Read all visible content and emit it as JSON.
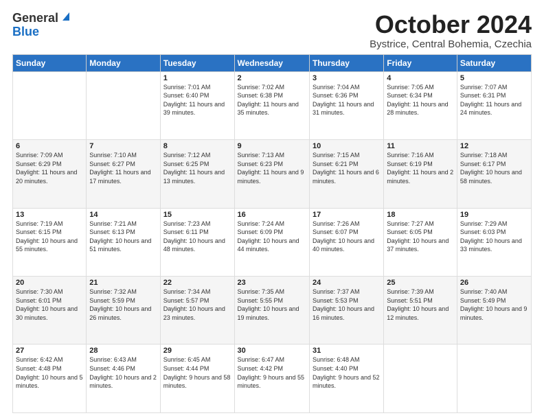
{
  "header": {
    "logo_general": "General",
    "logo_blue": "Blue",
    "month_title": "October 2024",
    "location": "Bystrice, Central Bohemia, Czechia"
  },
  "days_of_week": [
    "Sunday",
    "Monday",
    "Tuesday",
    "Wednesday",
    "Thursday",
    "Friday",
    "Saturday"
  ],
  "weeks": [
    [
      {
        "num": "",
        "info": ""
      },
      {
        "num": "",
        "info": ""
      },
      {
        "num": "1",
        "info": "Sunrise: 7:01 AM\nSunset: 6:40 PM\nDaylight: 11 hours and 39 minutes."
      },
      {
        "num": "2",
        "info": "Sunrise: 7:02 AM\nSunset: 6:38 PM\nDaylight: 11 hours and 35 minutes."
      },
      {
        "num": "3",
        "info": "Sunrise: 7:04 AM\nSunset: 6:36 PM\nDaylight: 11 hours and 31 minutes."
      },
      {
        "num": "4",
        "info": "Sunrise: 7:05 AM\nSunset: 6:34 PM\nDaylight: 11 hours and 28 minutes."
      },
      {
        "num": "5",
        "info": "Sunrise: 7:07 AM\nSunset: 6:31 PM\nDaylight: 11 hours and 24 minutes."
      }
    ],
    [
      {
        "num": "6",
        "info": "Sunrise: 7:09 AM\nSunset: 6:29 PM\nDaylight: 11 hours and 20 minutes."
      },
      {
        "num": "7",
        "info": "Sunrise: 7:10 AM\nSunset: 6:27 PM\nDaylight: 11 hours and 17 minutes."
      },
      {
        "num": "8",
        "info": "Sunrise: 7:12 AM\nSunset: 6:25 PM\nDaylight: 11 hours and 13 minutes."
      },
      {
        "num": "9",
        "info": "Sunrise: 7:13 AM\nSunset: 6:23 PM\nDaylight: 11 hours and 9 minutes."
      },
      {
        "num": "10",
        "info": "Sunrise: 7:15 AM\nSunset: 6:21 PM\nDaylight: 11 hours and 6 minutes."
      },
      {
        "num": "11",
        "info": "Sunrise: 7:16 AM\nSunset: 6:19 PM\nDaylight: 11 hours and 2 minutes."
      },
      {
        "num": "12",
        "info": "Sunrise: 7:18 AM\nSunset: 6:17 PM\nDaylight: 10 hours and 58 minutes."
      }
    ],
    [
      {
        "num": "13",
        "info": "Sunrise: 7:19 AM\nSunset: 6:15 PM\nDaylight: 10 hours and 55 minutes."
      },
      {
        "num": "14",
        "info": "Sunrise: 7:21 AM\nSunset: 6:13 PM\nDaylight: 10 hours and 51 minutes."
      },
      {
        "num": "15",
        "info": "Sunrise: 7:23 AM\nSunset: 6:11 PM\nDaylight: 10 hours and 48 minutes."
      },
      {
        "num": "16",
        "info": "Sunrise: 7:24 AM\nSunset: 6:09 PM\nDaylight: 10 hours and 44 minutes."
      },
      {
        "num": "17",
        "info": "Sunrise: 7:26 AM\nSunset: 6:07 PM\nDaylight: 10 hours and 40 minutes."
      },
      {
        "num": "18",
        "info": "Sunrise: 7:27 AM\nSunset: 6:05 PM\nDaylight: 10 hours and 37 minutes."
      },
      {
        "num": "19",
        "info": "Sunrise: 7:29 AM\nSunset: 6:03 PM\nDaylight: 10 hours and 33 minutes."
      }
    ],
    [
      {
        "num": "20",
        "info": "Sunrise: 7:30 AM\nSunset: 6:01 PM\nDaylight: 10 hours and 30 minutes."
      },
      {
        "num": "21",
        "info": "Sunrise: 7:32 AM\nSunset: 5:59 PM\nDaylight: 10 hours and 26 minutes."
      },
      {
        "num": "22",
        "info": "Sunrise: 7:34 AM\nSunset: 5:57 PM\nDaylight: 10 hours and 23 minutes."
      },
      {
        "num": "23",
        "info": "Sunrise: 7:35 AM\nSunset: 5:55 PM\nDaylight: 10 hours and 19 minutes."
      },
      {
        "num": "24",
        "info": "Sunrise: 7:37 AM\nSunset: 5:53 PM\nDaylight: 10 hours and 16 minutes."
      },
      {
        "num": "25",
        "info": "Sunrise: 7:39 AM\nSunset: 5:51 PM\nDaylight: 10 hours and 12 minutes."
      },
      {
        "num": "26",
        "info": "Sunrise: 7:40 AM\nSunset: 5:49 PM\nDaylight: 10 hours and 9 minutes."
      }
    ],
    [
      {
        "num": "27",
        "info": "Sunrise: 6:42 AM\nSunset: 4:48 PM\nDaylight: 10 hours and 5 minutes."
      },
      {
        "num": "28",
        "info": "Sunrise: 6:43 AM\nSunset: 4:46 PM\nDaylight: 10 hours and 2 minutes."
      },
      {
        "num": "29",
        "info": "Sunrise: 6:45 AM\nSunset: 4:44 PM\nDaylight: 9 hours and 58 minutes."
      },
      {
        "num": "30",
        "info": "Sunrise: 6:47 AM\nSunset: 4:42 PM\nDaylight: 9 hours and 55 minutes."
      },
      {
        "num": "31",
        "info": "Sunrise: 6:48 AM\nSunset: 4:40 PM\nDaylight: 9 hours and 52 minutes."
      },
      {
        "num": "",
        "info": ""
      },
      {
        "num": "",
        "info": ""
      }
    ]
  ]
}
